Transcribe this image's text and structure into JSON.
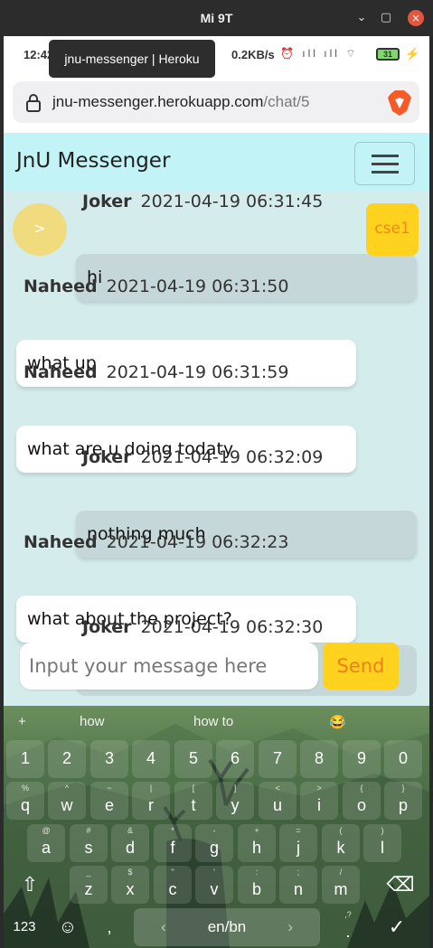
{
  "window": {
    "title": "Mi 9T",
    "minimize": "⌄",
    "maximize": "▢",
    "close": "×"
  },
  "statusbar": {
    "time": "12:42",
    "net_speed": "0.2KB/s",
    "icons": "⏰ ıll ıll ⌔",
    "battery": "31",
    "charging": "⚡"
  },
  "tooltip": "jnu-messenger | Heroku",
  "browser": {
    "url_host": "jnu-messenger.herokuapp.com",
    "url_path": "/chat/5"
  },
  "navbar": {
    "brand": "JnU Messenger"
  },
  "avatar": {
    "label": ">"
  },
  "group": {
    "label": "cse1"
  },
  "messages": [
    {
      "sender": "Joker",
      "time": "2021-04-19 06:31:45",
      "text": "hi",
      "mine": true
    },
    {
      "sender": "Naheed",
      "time": "2021-04-19 06:31:50",
      "text": "what up",
      "mine": false
    },
    {
      "sender": "Naheed",
      "time": "2021-04-19 06:31:59",
      "text": "what are u doing todaty",
      "mine": false
    },
    {
      "sender": "Joker",
      "time": "2021-04-19 06:32:09",
      "text": "nothing much",
      "mine": true
    },
    {
      "sender": "Naheed",
      "time": "2021-04-19 06:32:23",
      "text": "what about the project?",
      "mine": false
    },
    {
      "sender": "Joker",
      "time": "2021-04-19 06:32:30",
      "text": "",
      "mine": true
    }
  ],
  "composer": {
    "placeholder": "Input your message here",
    "send_label": "Send"
  },
  "keyboard": {
    "suggestions": [
      "+",
      "how",
      "how to",
      "😂"
    ],
    "number_row": [
      "1",
      "2",
      "3",
      "4",
      "5",
      "6",
      "7",
      "8",
      "9",
      "0"
    ],
    "row1": [
      {
        "k": "q",
        "h": "%"
      },
      {
        "k": "w",
        "h": "^"
      },
      {
        "k": "e",
        "h": "~"
      },
      {
        "k": "r",
        "h": "|"
      },
      {
        "k": "t",
        "h": "["
      },
      {
        "k": "y",
        "h": "]"
      },
      {
        "k": "u",
        "h": "<"
      },
      {
        "k": "i",
        "h": ">"
      },
      {
        "k": "o",
        "h": "{"
      },
      {
        "k": "p",
        "h": "}"
      }
    ],
    "row2": [
      {
        "k": "a",
        "h": "@"
      },
      {
        "k": "s",
        "h": "#"
      },
      {
        "k": "d",
        "h": "&"
      },
      {
        "k": "f",
        "h": "*"
      },
      {
        "k": "g",
        "h": "-"
      },
      {
        "k": "h",
        "h": "+"
      },
      {
        "k": "j",
        "h": "="
      },
      {
        "k": "k",
        "h": "("
      },
      {
        "k": "l",
        "h": ")"
      }
    ],
    "row3": [
      {
        "k": "z",
        "h": "_"
      },
      {
        "k": "x",
        "h": "$"
      },
      {
        "k": "c",
        "h": "\""
      },
      {
        "k": "v",
        "h": "'"
      },
      {
        "k": "b",
        "h": ":"
      },
      {
        "k": "n",
        "h": ";"
      },
      {
        "k": "m",
        "h": "/"
      }
    ],
    "shift": "⇧",
    "backspace": "⌫",
    "mode": "123",
    "emoji": "☺",
    "comma": ",",
    "space_label": "en/bn",
    "space_left": "‹",
    "space_right": "›",
    "period": ".",
    "period_hint": ",?",
    "enter": "✓"
  }
}
